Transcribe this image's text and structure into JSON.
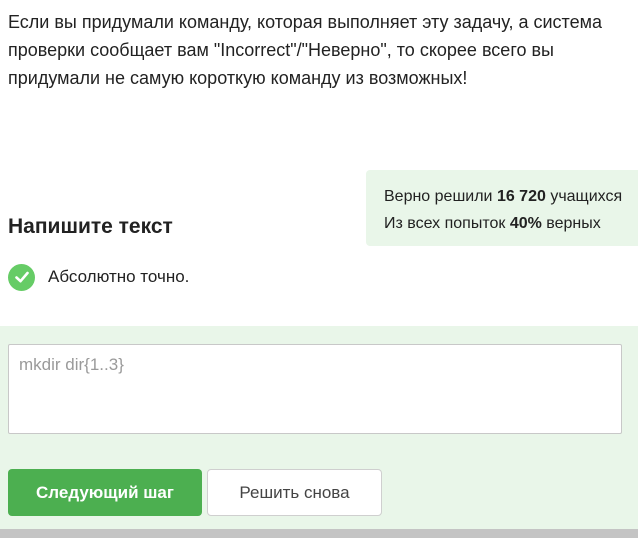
{
  "task": {
    "description": "Если вы придумали команду, которая выполняет эту задачу, а система проверки сообщает вам \"Incorrect\"/\"Неверно\", то скорее всего вы придумали не самую короткую команду из возможных!"
  },
  "stats": {
    "solved_prefix": "Верно решили ",
    "solved_count": "16 720",
    "solved_suffix": " учащихся",
    "attempts_prefix": "Из всех попыток ",
    "attempts_percent": "40%",
    "attempts_suffix": " верных"
  },
  "section": {
    "title": "Напишите текст"
  },
  "feedback": {
    "icon": "check-icon",
    "text": "Абсолютно точно.",
    "color": "#66cc66"
  },
  "answer": {
    "value": "mkdir dir{1..3}"
  },
  "buttons": {
    "next_label": "Следующий шаг",
    "retry_label": "Решить снова"
  },
  "colors": {
    "accent": "#4caf50",
    "panel_bg": "#e9f6e9"
  }
}
